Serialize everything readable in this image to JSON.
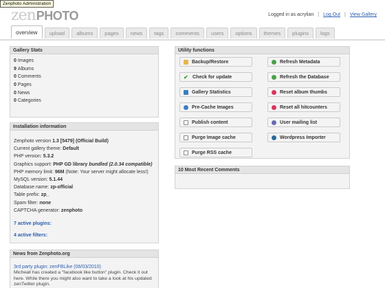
{
  "tooltip": "Zenphoto Administration",
  "logo": {
    "zen": "zen",
    "photo": "PHOTO"
  },
  "header": {
    "logged_in": "Logged in as acrylian",
    "separator": "|",
    "logout": "Log Out",
    "view_gallery": "View Gallery"
  },
  "tabs": [
    "overview",
    "upload",
    "albums",
    "pages",
    "news",
    "tags",
    "comments",
    "users",
    "options",
    "themes",
    "plugins",
    "logs"
  ],
  "gallery_stats": {
    "title": "Gallery Stats",
    "items": [
      {
        "count": "0",
        "label": "Images"
      },
      {
        "count": "9",
        "label": "Albums"
      },
      {
        "count": "0",
        "label": "Comments"
      },
      {
        "count": "0",
        "label": "Pages"
      },
      {
        "count": "0",
        "label": "News"
      },
      {
        "count": "0",
        "label": "Categories"
      }
    ]
  },
  "installation": {
    "title": "Installation information",
    "rows": [
      {
        "label": "Zenphoto version",
        "value": "1.3 [5479] (Official Build)"
      },
      {
        "label": "Current gallery theme:",
        "value": "Default"
      },
      {
        "label": "PHP version:",
        "value": "5.3.2"
      },
      {
        "label": "Graphics support:",
        "value": "PHP GD library",
        "extra": "bundled (2.0.34 compatible)"
      },
      {
        "label": "PHP memory limit:",
        "value": "96M",
        "note": "(Note: Your server might allocate less!)"
      },
      {
        "label": "MySQL version:",
        "value": "5.1.44"
      },
      {
        "label": "Database name:",
        "value": "zp-official"
      },
      {
        "label": "Table prefix:",
        "value": "zp_"
      },
      {
        "label": "Spam filter:",
        "value": "none"
      },
      {
        "label": "CAPTCHA generator:",
        "value": "zenphoto"
      }
    ],
    "active_plugins": "7 active plugins:",
    "active_filters": "4 active filters:"
  },
  "news": {
    "title": "News from Zenphoto.org",
    "item_title": "3rd party plugin: zenFBLike",
    "item_date": "(06/03/2010)",
    "item_body": "Micheall has created a \"facebook like button\" plugin. Check it out here. While there you might also want to take a look at his updated zenTwitter plugin."
  },
  "utility": {
    "title": "Utility functions",
    "left": [
      {
        "label": "Backup/Restore",
        "icon": "folder-icon"
      },
      {
        "label": "Check for update",
        "icon": "check-icon"
      },
      {
        "label": "Gallery Statistics",
        "icon": "chart-icon"
      },
      {
        "label": "Pre-Cache Images",
        "icon": "precache-icon"
      },
      {
        "label": "Publish content",
        "icon": "page-icon"
      },
      {
        "label": "Purge Image cache",
        "icon": "page-icon"
      },
      {
        "label": "Purge RSS cache",
        "icon": "page-icon"
      }
    ],
    "right": [
      {
        "label": "Refresh Metadata",
        "icon": "refresh-icon"
      },
      {
        "label": "Refresh the Database",
        "icon": "refresh-icon"
      },
      {
        "label": "Reset album thumbs",
        "icon": "reset-icon"
      },
      {
        "label": "Reset all hitcounters",
        "icon": "reset-icon"
      },
      {
        "label": "User mailing list",
        "icon": "user-icon"
      },
      {
        "label": "Wordpress Importer",
        "icon": "wordpress-icon"
      }
    ]
  },
  "recent_comments": {
    "title": "10 Most Recent Comments"
  }
}
